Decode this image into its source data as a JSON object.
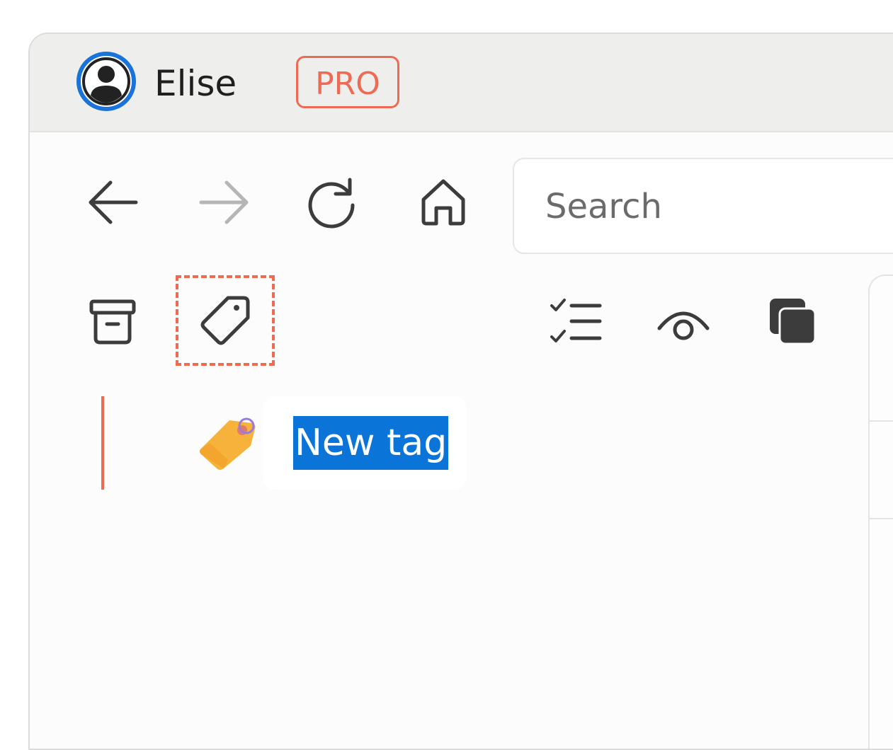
{
  "titlebar": {
    "user_name": "Elise",
    "badge": "PRO",
    "avatar_icon": "account-circle-icon"
  },
  "navigation": {
    "back_icon": "arrow-left-icon",
    "forward_icon": "arrow-right-icon",
    "reload_icon": "reload-icon",
    "home_icon": "home-icon",
    "search_placeholder": "Search"
  },
  "toolbar": {
    "items": [
      {
        "icon": "archive-icon"
      },
      {
        "icon": "tag-icon",
        "highlighted": true
      },
      {
        "icon": "checklist-icon"
      },
      {
        "icon": "eye-icon"
      },
      {
        "icon": "copy-icon"
      }
    ]
  },
  "tags": {
    "items": [
      {
        "label": "New tag",
        "icon": "tag-emoji-icon",
        "state": "editing-selected"
      }
    ]
  },
  "colors": {
    "accent": "#ee6a53",
    "selection": "#0a74d8",
    "avatar_ring": "#1a73d9",
    "icon": "#3c3c3c"
  }
}
